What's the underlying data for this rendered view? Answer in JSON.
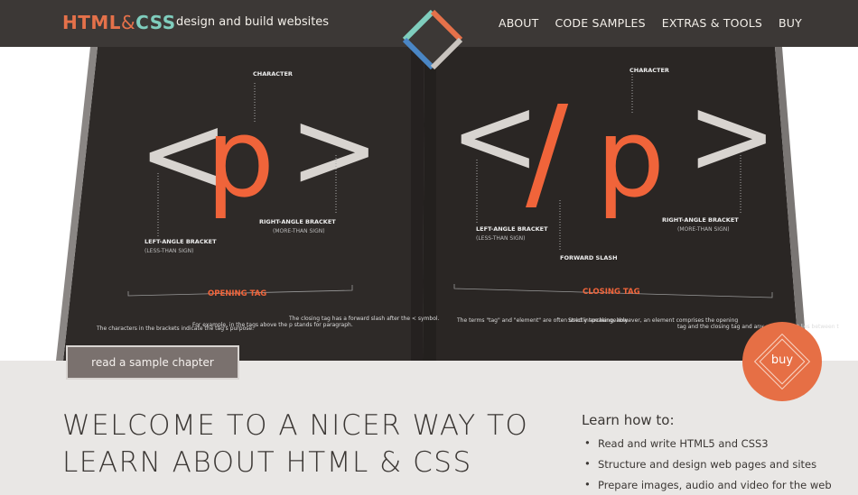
{
  "header": {
    "logo_html": "HTML",
    "logo_amp": "&",
    "logo_css": "CSS",
    "tagline": "design and build websites",
    "nav": [
      "ABOUT",
      "CODE SAMPLES",
      "EXTRAS & TOOLS",
      "BUY"
    ]
  },
  "hero": {
    "left_page": {
      "big_open": "<",
      "big_tag": "p",
      "big_close": ">",
      "label_character": "CHARACTER",
      "label_left_bracket": "LEFT-ANGLE BRACKET",
      "label_left_bracket_sub": "(LESS-THAN SIGN)",
      "label_right_bracket": "RIGHT-ANGLE BRACKET",
      "label_right_bracket_sub": "(MORE-THAN SIGN)",
      "label_tag": "OPENING TAG",
      "caption_1": "The characters in the brackets indicate the tag's purpose.",
      "caption_2": "For example, in the tags above the p stands for paragraph.",
      "caption_3": "The closing tag has a forward slash after the < symbol."
    },
    "right_page": {
      "big_open": "<",
      "big_slash": "/",
      "big_tag": "p",
      "big_close": ">",
      "label_character": "CHARACTER",
      "label_left_bracket": "LEFT-ANGLE BRACKET",
      "label_left_bracket_sub": "(LESS-THAN SIGN)",
      "label_right_bracket": "RIGHT-ANGLE BRACKET",
      "label_right_bracket_sub": "(MORE-THAN SIGN)",
      "label_slash": "FORWARD SLASH",
      "label_tag": "CLOSING TAG",
      "caption_1": "The terms \"tag\" and \"element\" are often used interchangeably.",
      "caption_2": "Strictly speaking, however, an element comprises the opening",
      "caption_3": "tag and the closing tag and any content that lies between t"
    },
    "read_button": "read a sample chapter",
    "buy_button": "buy"
  },
  "main": {
    "welcome": "WELCOME TO A NICER WAY TO LEARN ABOUT HTML & CSS",
    "learn_heading": "Learn how to:",
    "learn_items": [
      "Read and write HTML5 and CSS3",
      "Structure and design web pages and sites",
      "Prepare images, audio and video for the web"
    ]
  },
  "colors": {
    "header_bg": "#3c3836",
    "accent_orange": "#e66f45",
    "accent_teal": "#7fcdbd",
    "book_page": "#2c2826"
  }
}
